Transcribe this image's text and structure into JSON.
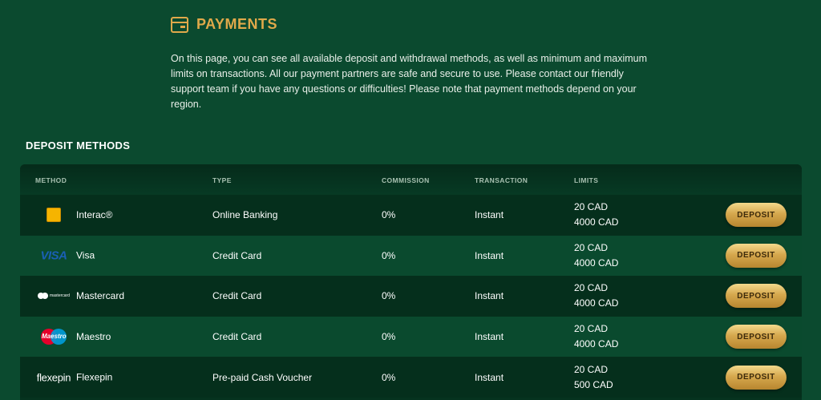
{
  "header": {
    "title": "PAYMENTS",
    "icon": "wallet-icon"
  },
  "intro": "On this page, you can see all available deposit and withdrawal methods, as well as minimum and maximum limits on transactions. All our payment partners are safe and secure to use. Please contact our friendly support team if you have any questions or difficulties! Please note that payment methods depend on your region.",
  "section_title": "DEPOSIT METHODS",
  "columns": {
    "method": "METHOD",
    "type": "TYPE",
    "commission": "COMMISSION",
    "transaction": "TRANSACTION",
    "limits": "LIMITS"
  },
  "rows": [
    {
      "method": "Interac®",
      "logo": "interac-logo",
      "type": "Online Banking",
      "commission": "0%",
      "transaction": "Instant",
      "min": "20 CAD",
      "max": "4000 CAD",
      "button": "DEPOSIT"
    },
    {
      "method": "Visa",
      "logo": "visa-logo",
      "logo_text": "VISA",
      "type": "Credit Card",
      "commission": "0%",
      "transaction": "Instant",
      "min": "20 CAD",
      "max": "4000 CAD",
      "button": "DEPOSIT"
    },
    {
      "method": "Mastercard",
      "logo": "mastercard-logo",
      "logo_text": "mastercard",
      "type": "Credit Card",
      "commission": "0%",
      "transaction": "Instant",
      "min": "20 CAD",
      "max": "4000 CAD",
      "button": "DEPOSIT"
    },
    {
      "method": "Maestro",
      "logo": "maestro-logo",
      "logo_text": "Maestro",
      "type": "Credit Card",
      "commission": "0%",
      "transaction": "Instant",
      "min": "20 CAD",
      "max": "4000 CAD",
      "button": "DEPOSIT"
    },
    {
      "method": "Flexepin",
      "logo": "flexepin-logo",
      "logo_text": "flexepin",
      "type": "Pre-paid Cash Voucher",
      "commission": "0%",
      "transaction": "Instant",
      "min": "20 CAD",
      "max": "500 CAD",
      "button": "DEPOSIT"
    }
  ],
  "colors": {
    "background": "#0b4a2f",
    "accent": "#e0a94a",
    "button_gold": "#d6a84e"
  }
}
